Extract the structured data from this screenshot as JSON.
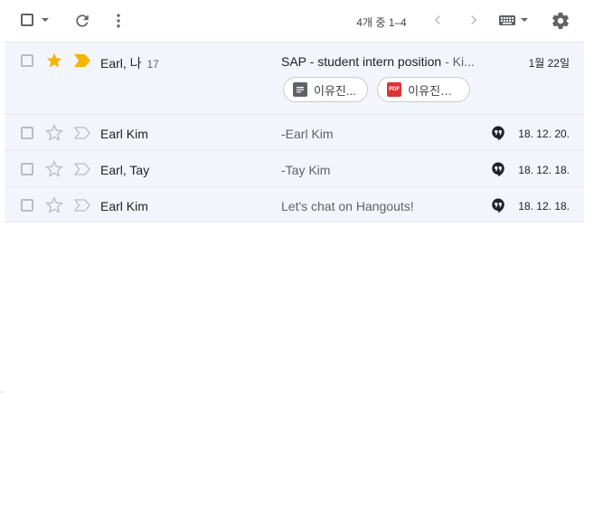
{
  "toolbar": {
    "page_info": "4개 중 1–4",
    "icons": [
      "checkbox-icon",
      "caret-down-icon",
      "refresh-icon",
      "more-vert-icon",
      "chevron-left-icon",
      "chevron-right-icon",
      "keyboard-icon",
      "gear-icon"
    ]
  },
  "emails": [
    {
      "sender": "Earl, 나",
      "count": "17",
      "subject": "SAP - student intern position",
      "snippet": " - Ki...",
      "date": "1월 22일",
      "starred": true,
      "important": true,
      "attachments": [
        {
          "label": "이유진...",
          "type": "doc"
        },
        {
          "label": "이유진_c...",
          "type": "pdf",
          "icon_text": "PDF"
        }
      ]
    },
    {
      "sender": "Earl Kim",
      "subject": "-Earl Kim",
      "date": "18. 12. 20.",
      "starred": false,
      "important": false,
      "hangout": true
    },
    {
      "sender": "Earl, Tay",
      "subject": "-Tay Kim",
      "date": "18. 12. 18.",
      "starred": false,
      "important": false,
      "hangout": true
    },
    {
      "sender": "Earl Kim",
      "subject": "Let's chat on Hangouts!",
      "date": "18. 12. 18.",
      "starred": false,
      "important": false,
      "hangout": true
    }
  ],
  "colors": {
    "row_bg": "#f2f6fc",
    "star": "#f4b400",
    "important": "#f4b400",
    "pdf": "#db3236",
    "icon": "#5f6368"
  }
}
